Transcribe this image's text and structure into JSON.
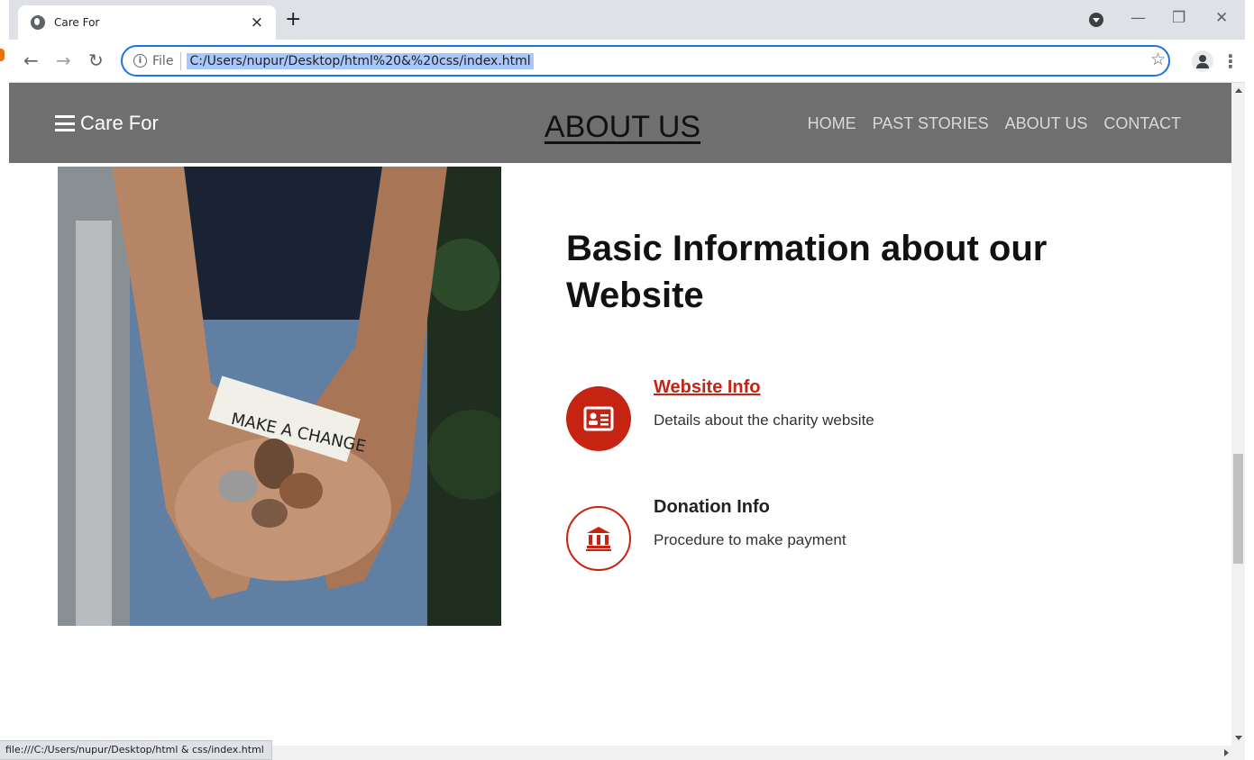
{
  "browser": {
    "tab_title": "Care For",
    "tab_close": "×",
    "new_tab": "+",
    "address_scheme_label": "File",
    "url": "C:/Users/nupur/Desktop/html%20&%20css/index.html",
    "status_url": "file:///C:/Users/nupur/Desktop/html & css/index.html",
    "icons": {
      "back": "arrow-left-icon",
      "forward": "arrow-right-icon",
      "reload": "reload-icon",
      "info": "info-icon",
      "star": "star-icon",
      "profile": "profile-icon",
      "menu": "menu-dots-icon",
      "minimize": "minimize-icon",
      "restore": "restore-icon",
      "close": "close-icon"
    },
    "accent_color": "#1a73e8"
  },
  "site": {
    "brand": "Care For",
    "nav": [
      {
        "label": "HOME"
      },
      {
        "label": "PAST STORIES"
      },
      {
        "label": "ABOUT US"
      },
      {
        "label": "CONTACT"
      }
    ],
    "nav_background": "#6f6f6f"
  },
  "about": {
    "section_title": "ABOUT US",
    "photo_text": "MAKE A CHANGE",
    "heading": "Basic Information about our Website",
    "features": [
      {
        "title": "Website Info",
        "description": "Details about the charity website",
        "icon": "id-card-icon"
      },
      {
        "title": "Donation Info",
        "description": "Procedure to make payment",
        "icon": "bank-icon"
      }
    ],
    "accent_color": "#c62413"
  }
}
